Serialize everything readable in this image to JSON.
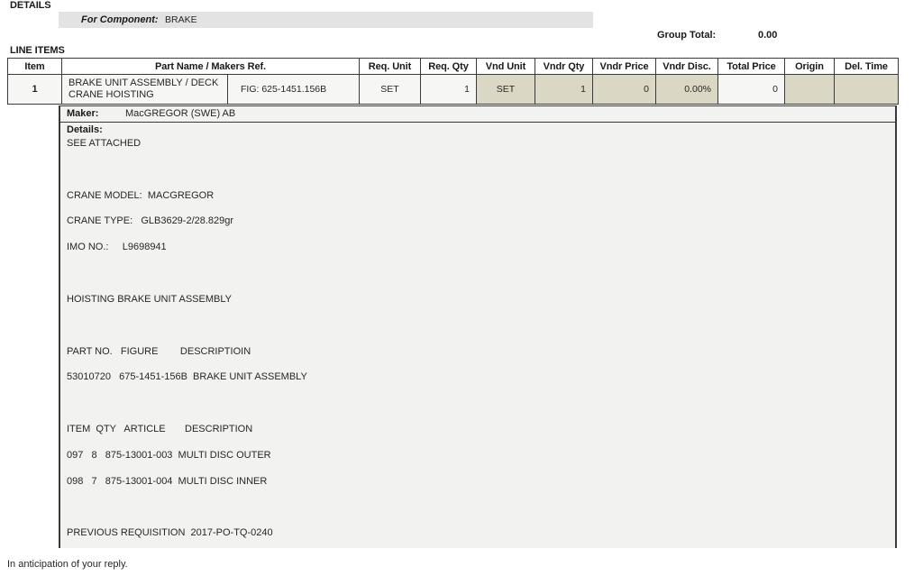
{
  "headings": {
    "details": "DETAILS",
    "line_items": "LINE ITEMS"
  },
  "component": {
    "label": "For Component:",
    "value": "BRAKE"
  },
  "group_total": {
    "label": "Group Total:",
    "value": "0.00"
  },
  "table": {
    "columns": [
      "Item",
      "Part Name / Makers Ref.",
      "Req. Unit",
      "Req. Qty",
      "Vnd Unit",
      "Vndr Qty",
      "Vndr Price",
      "Vndr Disc.",
      "Total Price",
      "Origin",
      "Del. Time"
    ],
    "row": {
      "item": "1",
      "part_name": "BRAKE UNIT ASSEMBLY / DECK CRANE HOISTING",
      "makers_ref": "FIG: 625-1451.156B",
      "req_unit": "SET",
      "req_qty": "1",
      "vnd_unit": "SET",
      "vndr_qty": "1",
      "vndr_price": "0",
      "vndr_disc": "0.00%",
      "total_price": "0",
      "origin": "",
      "del_time": ""
    }
  },
  "details_panel": {
    "maker_label": "Maker:",
    "maker_value": "MacGREGOR (SWE) AB",
    "details_label": "Details:",
    "details_text": "SEE ATTACHED\n\n\n\nCRANE MODEL:  MACGREGOR\n\nCRANE TYPE:   GLB3629-2/28.829gr\n\nIMO NO.:     L9698941\n\n\n\nHOISTING BRAKE UNIT ASSEMBLY\n\n\n\nPART NO.   FIGURE        DESCRIPTIOIN\n\n53010720   675-1451-156B  BRAKE UNIT ASSEMBLY\n\n\n\nITEM  QTY   ARTICLE       DESCRIPTION\n\n097   8   875-13001-003  MULTI DISC OUTER\n\n098   7   875-13001-004  MULTI DISC INNER\n\n\n\nPREVIOUS REQUISITION  2017-PO-TQ-0240"
  },
  "footer": {
    "text": "In anticipation of your reply."
  },
  "colors": {
    "beige_cell": "#dbd7c5",
    "light_cell": "#f6f6f4",
    "component_bar": "#e3e3e3",
    "panel_bg": "#f2f2f0",
    "border": "#3a3a3a"
  }
}
